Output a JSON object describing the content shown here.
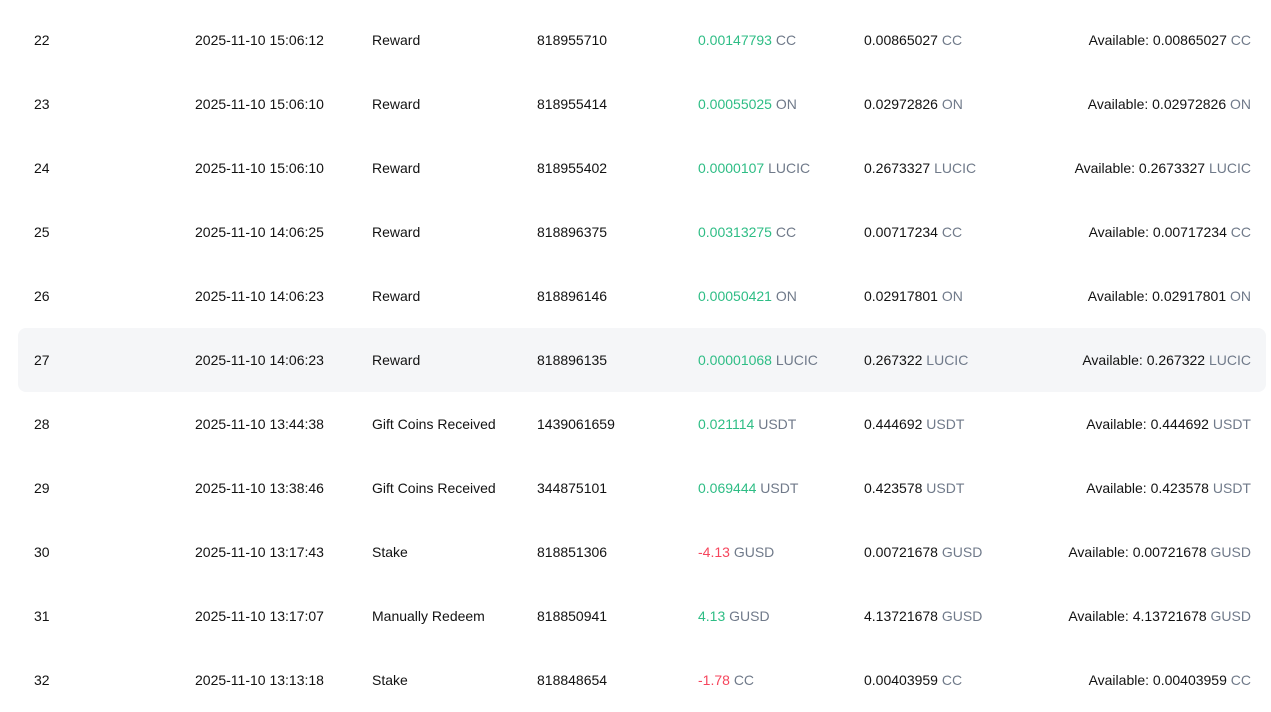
{
  "rows": [
    {
      "id": "22",
      "time": "2025-11-10 15:06:12",
      "type": "Reward",
      "order": "818955710",
      "change": "0.00147793",
      "change_sign": "pos",
      "change_unit": "CC",
      "balance": "0.00865027",
      "balance_unit": "CC",
      "available_label": "Available:",
      "available": "0.00865027",
      "available_unit": "CC"
    },
    {
      "id": "23",
      "time": "2025-11-10 15:06:10",
      "type": "Reward",
      "order": "818955414",
      "change": "0.00055025",
      "change_sign": "pos",
      "change_unit": "ON",
      "balance": "0.02972826",
      "balance_unit": "ON",
      "available_label": "Available:",
      "available": "0.02972826",
      "available_unit": "ON"
    },
    {
      "id": "24",
      "time": "2025-11-10 15:06:10",
      "type": "Reward",
      "order": "818955402",
      "change": "0.0000107",
      "change_sign": "pos",
      "change_unit": "LUCIC",
      "balance": "0.2673327",
      "balance_unit": "LUCIC",
      "available_label": "Available:",
      "available": "0.2673327",
      "available_unit": "LUCIC"
    },
    {
      "id": "25",
      "time": "2025-11-10 14:06:25",
      "type": "Reward",
      "order": "818896375",
      "change": "0.00313275",
      "change_sign": "pos",
      "change_unit": "CC",
      "balance": "0.00717234",
      "balance_unit": "CC",
      "available_label": "Available:",
      "available": "0.00717234",
      "available_unit": "CC"
    },
    {
      "id": "26",
      "time": "2025-11-10 14:06:23",
      "type": "Reward",
      "order": "818896146",
      "change": "0.00050421",
      "change_sign": "pos",
      "change_unit": "ON",
      "balance": "0.02917801",
      "balance_unit": "ON",
      "available_label": "Available:",
      "available": "0.02917801",
      "available_unit": "ON"
    },
    {
      "id": "27",
      "time": "2025-11-10 14:06:23",
      "type": "Reward",
      "order": "818896135",
      "change": "0.00001068",
      "change_sign": "pos",
      "change_unit": "LUCIC",
      "balance": "0.267322",
      "balance_unit": "LUCIC",
      "available_label": "Available:",
      "available": "0.267322",
      "available_unit": "LUCIC",
      "highlighted": true
    },
    {
      "id": "28",
      "time": "2025-11-10 13:44:38",
      "type": "Gift Coins Received",
      "order": "1439061659",
      "change": "0.021114",
      "change_sign": "pos",
      "change_unit": "USDT",
      "balance": "0.444692",
      "balance_unit": "USDT",
      "available_label": "Available:",
      "available": "0.444692",
      "available_unit": "USDT"
    },
    {
      "id": "29",
      "time": "2025-11-10 13:38:46",
      "type": "Gift Coins Received",
      "order": "344875101",
      "change": "0.069444",
      "change_sign": "pos",
      "change_unit": "USDT",
      "balance": "0.423578",
      "balance_unit": "USDT",
      "available_label": "Available:",
      "available": "0.423578",
      "available_unit": "USDT"
    },
    {
      "id": "30",
      "time": "2025-11-10 13:17:43",
      "type": "Stake",
      "order": "818851306",
      "change": "-4.13",
      "change_sign": "neg",
      "change_unit": "GUSD",
      "balance": "0.00721678",
      "balance_unit": "GUSD",
      "available_label": "Available:",
      "available": "0.00721678",
      "available_unit": "GUSD"
    },
    {
      "id": "31",
      "time": "2025-11-10 13:17:07",
      "type": "Manually Redeem",
      "order": "818850941",
      "change": "4.13",
      "change_sign": "pos",
      "change_unit": "GUSD",
      "balance": "4.13721678",
      "balance_unit": "GUSD",
      "available_label": "Available:",
      "available": "4.13721678",
      "available_unit": "GUSD"
    },
    {
      "id": "32",
      "time": "2025-11-10 13:13:18",
      "type": "Stake",
      "order": "818848654",
      "change": "-1.78",
      "change_sign": "neg",
      "change_unit": "CC",
      "balance": "0.00403959",
      "balance_unit": "CC",
      "available_label": "Available:",
      "available": "0.00403959",
      "available_unit": "CC"
    }
  ],
  "colors": {
    "positive": "#2ebd85",
    "negative": "#f6465d",
    "unit": "#707a8a",
    "text": "#121212",
    "row_highlight": "#f5f6f8"
  }
}
